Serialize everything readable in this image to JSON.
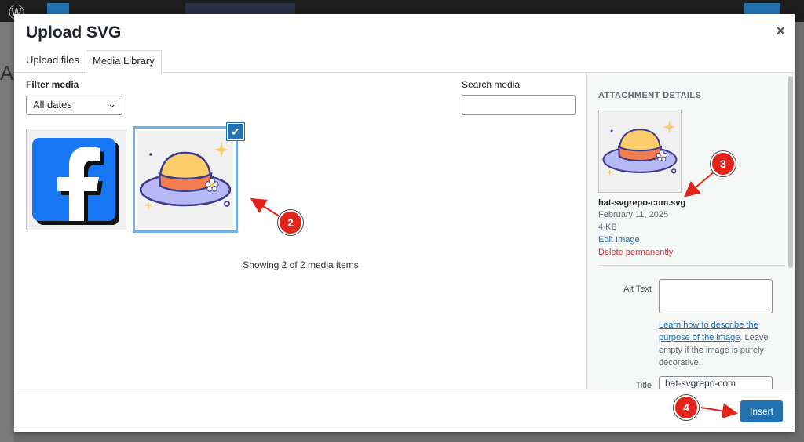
{
  "background": {
    "partial_letter": "A"
  },
  "modal": {
    "title": "Upload SVG",
    "close_symbol": "×",
    "tabs": [
      {
        "label": "Upload files",
        "active": false
      },
      {
        "label": "Media Library",
        "active": true
      }
    ]
  },
  "browser": {
    "filter_label": "Filter media",
    "date_filter": "All dates",
    "search_label": "Search media",
    "search_value": "",
    "items": [
      {
        "name": "facebook-logo",
        "icon": "facebook-icon",
        "selected": false
      },
      {
        "name": "hat-svgrepo-com.svg",
        "icon": "hat-icon",
        "selected": true
      }
    ],
    "status": "Showing 2 of 2 media items"
  },
  "details": {
    "heading": "ATTACHMENT DETAILS",
    "filename": "hat-svgrepo-com.svg",
    "date": "February 11, 2025",
    "size": "4 KB",
    "edit_link": "Edit Image",
    "delete_link": "Delete permanently",
    "alt_label": "Alt Text",
    "alt_value": "",
    "alt_help_link": "Learn how to describe the purpose of the image",
    "alt_help_text": ". Leave empty if the image is purely decorative.",
    "title_label": "Title",
    "title_value": "hat-svgrepo-com"
  },
  "footer": {
    "insert_label": "Insert"
  },
  "callouts": [
    "2",
    "3",
    "4"
  ],
  "colors": {
    "accent": "#2271b1",
    "danger": "#d63638",
    "callout": "#e2231a",
    "hat_top": "#fbcd6a",
    "hat_band": "#f27d4d",
    "hat_brim": "#b6b9f5"
  }
}
